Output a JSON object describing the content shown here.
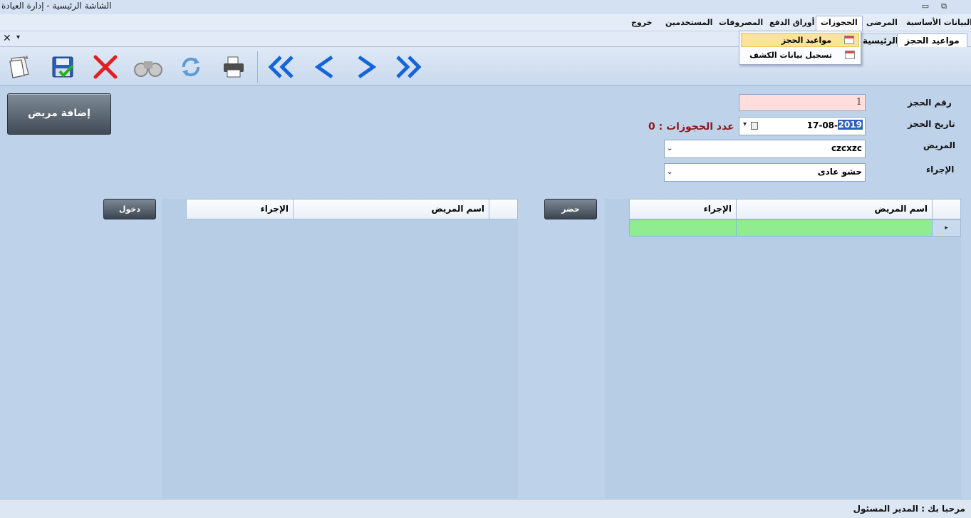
{
  "window": {
    "title": "الشاشة الرئيسية - إدارة العيادة",
    "minimize_glyph": "▭",
    "restore_glyph": "⧉"
  },
  "menu": {
    "items": [
      "البيانات الأساسية",
      "المرضى",
      "الحجوزات",
      "أوراق الدفع",
      "المصروفات",
      "المستخدمين",
      "خروج"
    ],
    "active": "الحجوزات"
  },
  "dropdown": {
    "items": [
      "مواعيد الحجز",
      "تسجيل بيانات الكشف"
    ],
    "highlighted": "مواعيد الحجز"
  },
  "tabs": {
    "items": [
      "مواعيد الحجز",
      "الرئيسية"
    ],
    "active": "مواعيد الحجز",
    "close_glyph": "✕",
    "pin_glyph": "▾"
  },
  "toolbar": {
    "buttons": [
      "new-icon",
      "save-icon",
      "delete-icon",
      "search-icon",
      "refresh-icon",
      "print-icon",
      "first-icon",
      "previous-icon",
      "next-icon",
      "last-icon"
    ]
  },
  "form": {
    "booking_number_label": "رقم الحجز",
    "booking_number_value": "1",
    "booking_date_label": "تاريخ الحجز",
    "booking_date_value": "17-08-",
    "booking_date_year": "2019",
    "patient_label": "المريض",
    "patient_value": "czcxzc",
    "procedure_label": "الإجراء",
    "procedure_value": "حشو عادى",
    "bookings_count_label": "عدد الحجوزات :",
    "bookings_count_value": "0",
    "add_patient_button": "إضافة مريض"
  },
  "grid_left": {
    "columns": [
      "اسم المريض",
      "الإجراء"
    ],
    "rows": [
      [
        "",
        ""
      ]
    ],
    "action_button": "حضر"
  },
  "grid_right": {
    "columns": [
      "اسم المريض",
      "الإجراء"
    ],
    "rows": [],
    "action_button": "دخول"
  },
  "status": {
    "text": "مرحبا بك :  المدير المسئول"
  },
  "colors": {
    "background": "#bed2ea",
    "row_green": "#8fec8f",
    "count_red": "#8b1a1a",
    "pink_field": "#fddedd"
  }
}
